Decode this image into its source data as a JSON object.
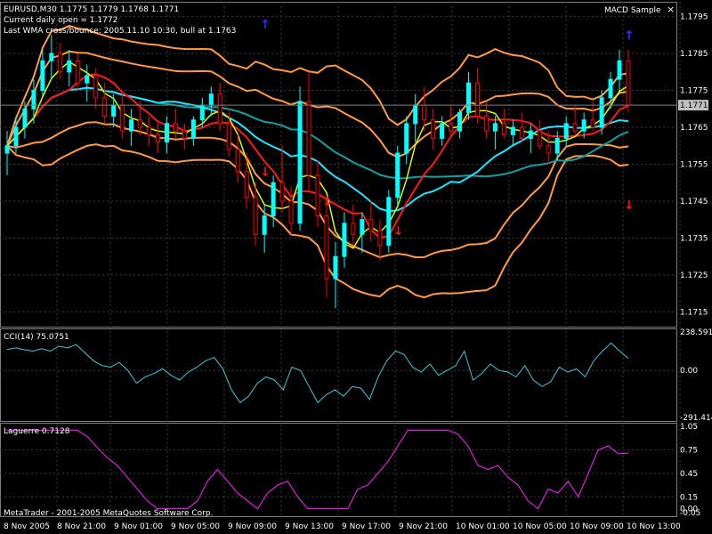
{
  "header": {
    "line1": "EURUSD,M30  1.1775 1.1779 1.1768 1.1771",
    "line2": "Current daily open = 1.1772",
    "line3": "Last WMA cross/bounce: 2005.11.10 10:30, bull at 1.1763",
    "ea_label": "MACD Sample",
    "close_glyph": "×"
  },
  "footer": {
    "copyright": "MetaTrader - 2001-2005 MetaQuotes Software Corp."
  },
  "colors": {
    "background": "#000000",
    "grid": "#3c3c3c",
    "bull_candle": "#00ffff",
    "bear_candle": "#ff0000",
    "bollinger": "#ff9a4a",
    "ma_fast": "#d7ff00",
    "ma_mid": "#ff1a1a",
    "ma_slow_cyan": "#22e4ff",
    "ma_slow_teal": "#14a0a0",
    "ma_salmon": "#ff8a60",
    "cci": "#3cc8d8",
    "laguerre": "#ff20ff",
    "arrow_up": "#2b2bff",
    "arrow_down": "#ff1010",
    "current_price_box": "#c0c0c0"
  },
  "chart_data": [
    {
      "type": "candlestick",
      "symbol": "EURUSD",
      "timeframe": "M30",
      "ylim": [
        1.1711,
        1.1799
      ],
      "y_ticks": [
        "1.1795",
        "1.1785",
        "1.1775",
        "1.1765",
        "1.1755",
        "1.1745",
        "1.1735",
        "1.1725",
        "1.1715"
      ],
      "current_price": "1.1771",
      "x_ticks": [
        "8 Nov 2005",
        "8 Nov 21:00",
        "9 Nov 01:00",
        "9 Nov 05:00",
        "9 Nov 09:00",
        "9 Nov 13:00",
        "9 Nov 17:00",
        "9 Nov 21:00",
        "10 Nov 01:00",
        "10 Nov 05:00",
        "10 Nov 09:00",
        "10 Nov 13:00"
      ],
      "candles_ohlc": [
        [
          1.1758,
          1.1764,
          1.1752,
          1.176
        ],
        [
          1.176,
          1.1768,
          1.1758,
          1.1765
        ],
        [
          1.1765,
          1.1772,
          1.1762,
          1.177
        ],
        [
          1.177,
          1.1778,
          1.1766,
          1.1775
        ],
        [
          1.1775,
          1.1786,
          1.1773,
          1.1783
        ],
        [
          1.1783,
          1.179,
          1.1778,
          1.1785
        ],
        [
          1.1785,
          1.1788,
          1.1778,
          1.178
        ],
        [
          1.178,
          1.1786,
          1.1776,
          1.1783
        ],
        [
          1.1783,
          1.1785,
          1.1775,
          1.1777
        ],
        [
          1.1777,
          1.1782,
          1.1772,
          1.1779
        ],
        [
          1.1779,
          1.1781,
          1.177,
          1.1773
        ],
        [
          1.1773,
          1.1777,
          1.1766,
          1.1768
        ],
        [
          1.1768,
          1.1774,
          1.1765,
          1.1771
        ],
        [
          1.1771,
          1.1775,
          1.1762,
          1.1764
        ],
        [
          1.1764,
          1.177,
          1.176,
          1.1767
        ],
        [
          1.1767,
          1.1772,
          1.1763,
          1.1765
        ],
        [
          1.1765,
          1.1768,
          1.176,
          1.1763
        ],
        [
          1.1763,
          1.1767,
          1.1758,
          1.1761
        ],
        [
          1.1761,
          1.1768,
          1.1758,
          1.1766
        ],
        [
          1.1766,
          1.177,
          1.1762,
          1.1764
        ],
        [
          1.1764,
          1.1766,
          1.1759,
          1.1762
        ],
        [
          1.1762,
          1.1768,
          1.176,
          1.1767
        ],
        [
          1.1767,
          1.1773,
          1.1765,
          1.1771
        ],
        [
          1.1771,
          1.1776,
          1.1768,
          1.1774
        ],
        [
          1.1774,
          1.1777,
          1.1764,
          1.1766
        ],
        [
          1.1766,
          1.177,
          1.1757,
          1.1759
        ],
        [
          1.1759,
          1.1763,
          1.175,
          1.1753
        ],
        [
          1.1753,
          1.1758,
          1.1743,
          1.1746
        ],
        [
          1.1746,
          1.175,
          1.1733,
          1.1736
        ],
        [
          1.1736,
          1.1744,
          1.1731,
          1.1741
        ],
        [
          1.1741,
          1.1752,
          1.1738,
          1.175
        ],
        [
          1.175,
          1.176,
          1.1742,
          1.1745
        ],
        [
          1.1745,
          1.1749,
          1.1736,
          1.1739
        ],
        [
          1.1739,
          1.1776,
          1.1737,
          1.1772
        ],
        [
          1.1772,
          1.178,
          1.1748,
          1.1752
        ],
        [
          1.1752,
          1.1756,
          1.1738,
          1.1741
        ],
        [
          1.1741,
          1.1746,
          1.1719,
          1.1724
        ],
        [
          1.1724,
          1.1734,
          1.1716,
          1.173
        ],
        [
          1.173,
          1.1742,
          1.1727,
          1.1739
        ],
        [
          1.1739,
          1.1744,
          1.1733,
          1.1736
        ],
        [
          1.1736,
          1.1742,
          1.1731,
          1.174
        ],
        [
          1.174,
          1.1745,
          1.1734,
          1.1737
        ],
        [
          1.1737,
          1.174,
          1.1729,
          1.1733
        ],
        [
          1.1733,
          1.1748,
          1.1731,
          1.1746
        ],
        [
          1.1746,
          1.176,
          1.1744,
          1.1758
        ],
        [
          1.1758,
          1.1768,
          1.1755,
          1.1766
        ],
        [
          1.1766,
          1.1774,
          1.1761,
          1.1771
        ],
        [
          1.1771,
          1.1776,
          1.1764,
          1.1767
        ],
        [
          1.1767,
          1.177,
          1.1759,
          1.1762
        ],
        [
          1.1762,
          1.1768,
          1.176,
          1.1766
        ],
        [
          1.1766,
          1.1771,
          1.1762,
          1.1764
        ],
        [
          1.1764,
          1.177,
          1.1762,
          1.1769
        ],
        [
          1.1769,
          1.178,
          1.1767,
          1.1777
        ],
        [
          1.1777,
          1.1781,
          1.1766,
          1.1768
        ],
        [
          1.1768,
          1.1772,
          1.1762,
          1.1764
        ],
        [
          1.1764,
          1.1768,
          1.1759,
          1.1766
        ],
        [
          1.1766,
          1.177,
          1.1762,
          1.1763
        ],
        [
          1.1763,
          1.1767,
          1.176,
          1.1765
        ],
        [
          1.1765,
          1.1769,
          1.1761,
          1.1762
        ],
        [
          1.1762,
          1.1766,
          1.1758,
          1.1764
        ],
        [
          1.1764,
          1.1767,
          1.1759,
          1.176
        ],
        [
          1.176,
          1.1764,
          1.1755,
          1.1758
        ],
        [
          1.1758,
          1.1764,
          1.1756,
          1.1762
        ],
        [
          1.1762,
          1.1768,
          1.176,
          1.1766
        ],
        [
          1.1766,
          1.1771,
          1.1763,
          1.1764
        ],
        [
          1.1764,
          1.1769,
          1.1762,
          1.1767
        ],
        [
          1.1767,
          1.1772,
          1.1764,
          1.1765
        ],
        [
          1.1765,
          1.1775,
          1.1763,
          1.1773
        ],
        [
          1.1773,
          1.178,
          1.177,
          1.1778
        ],
        [
          1.1778,
          1.1786,
          1.1775,
          1.1783
        ],
        [
          1.1783,
          1.1786,
          1.1769,
          1.1771
        ]
      ],
      "signal_arrows": [
        {
          "bar": 29,
          "direction": "up",
          "price": 1.1793
        },
        {
          "bar": 29,
          "direction": "down",
          "price": 1.1753
        },
        {
          "bar": 36,
          "direction": "down",
          "price": 1.1745
        },
        {
          "bar": 44,
          "direction": "down",
          "price": 1.1737
        },
        {
          "bar": 76,
          "direction": "down",
          "price": 1.1744
        },
        {
          "bar": 76,
          "direction": "up",
          "price": 1.179
        },
        {
          "bar": 78,
          "direction": "up",
          "price": 1.179
        },
        {
          "bar": 81,
          "direction": "up",
          "price": 1.179
        }
      ]
    },
    {
      "type": "line",
      "title": "CCI(14) 75.0751",
      "y_ticks": [
        "238.5916",
        "0.00",
        "-291.414"
      ],
      "ylim": [
        -291.414,
        238.5916
      ],
      "series": [
        {
          "values": [
            130,
            140,
            128,
            120,
            135,
            120,
            150,
            140,
            160,
            110,
            60,
            30,
            20,
            50,
            0,
            -80,
            -40,
            -20,
            10,
            -30,
            -60,
            -10,
            20,
            60,
            80,
            10,
            -120,
            -200,
            -160,
            -80,
            -40,
            -60,
            -120,
            20,
            0,
            -100,
            -200,
            -150,
            -120,
            -160,
            -100,
            -110,
            -180,
            -40,
            60,
            120,
            100,
            20,
            -10,
            40,
            -30,
            0,
            30,
            120,
            -60,
            -20,
            40,
            0,
            -10,
            -40,
            30,
            -60,
            -100,
            -70,
            20,
            -10,
            10,
            -40,
            60,
            120,
            170,
            120,
            75
          ]
        }
      ]
    },
    {
      "type": "line",
      "title": "Laguerre 0.7128",
      "y_ticks": [
        "1.05",
        "0.75",
        "0.45",
        "0.15",
        "0.00",
        "-0.05"
      ],
      "ylim": [
        -0.05,
        1.05
      ],
      "series": [
        {
          "values": [
            1.0,
            1.0,
            1.0,
            1.0,
            1.0,
            1.0,
            1.0,
            1.0,
            0.92,
            0.78,
            0.65,
            0.55,
            0.4,
            0.25,
            0.1,
            0.0,
            0.0,
            0.0,
            0.0,
            0.1,
            0.35,
            0.5,
            0.35,
            0.2,
            0.1,
            0.0,
            0.2,
            0.3,
            0.35,
            0.15,
            0.0,
            0.0,
            0.0,
            0.0,
            0.0,
            0.25,
            0.3,
            0.45,
            0.6,
            0.8,
            1.0,
            1.0,
            1.0,
            1.0,
            1.0,
            0.95,
            0.8,
            0.55,
            0.5,
            0.55,
            0.4,
            0.3,
            0.1,
            0.0,
            0.25,
            0.2,
            0.35,
            0.15,
            0.45,
            0.75,
            0.8,
            0.7,
            0.71
          ]
        }
      ]
    }
  ]
}
